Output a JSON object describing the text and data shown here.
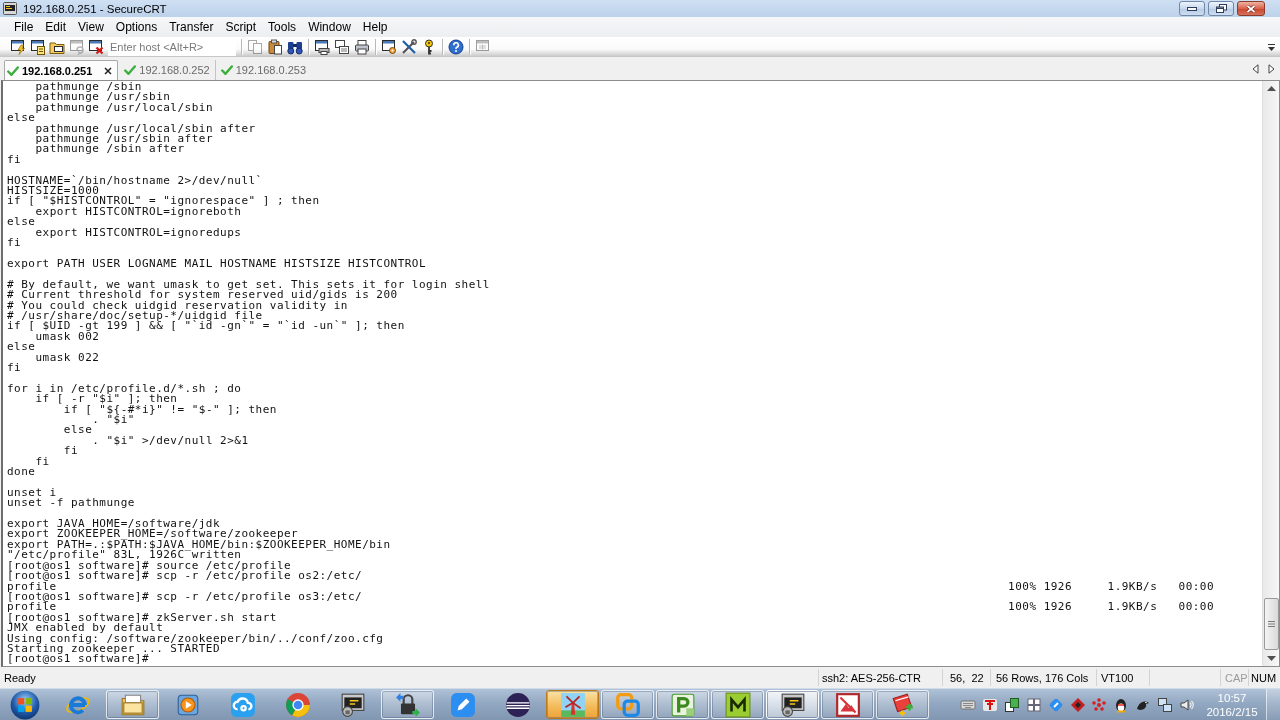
{
  "window": {
    "title": "192.168.0.251 - SecureCRT"
  },
  "menu": [
    "File",
    "Edit",
    "View",
    "Options",
    "Transfer",
    "Script",
    "Tools",
    "Window",
    "Help"
  ],
  "toolbar": {
    "session_buttons": [
      {
        "disabled": false
      },
      {
        "disabled": false
      },
      {
        "disabled": false
      },
      {
        "disabled": true
      },
      {
        "disabled": false
      }
    ],
    "host_field": {
      "placeholder": "Enter host <Alt+R>"
    },
    "groups": [
      [
        {
          "disabled": true
        },
        {
          "disabled": false
        },
        {
          "disabled": false
        }
      ],
      [
        {
          "disabled": false
        },
        {
          "disabled": false
        },
        {
          "disabled": false
        }
      ],
      [
        {
          "disabled": false
        },
        {
          "disabled": false
        },
        {
          "disabled": false
        }
      ],
      [
        {
          "disabled": false
        }
      ],
      [
        {
          "disabled": true
        }
      ]
    ]
  },
  "tabs": [
    {
      "label": "192.168.0.251",
      "selected": true,
      "connected": true
    },
    {
      "label": "192.168.0.252",
      "selected": false,
      "connected": true
    },
    {
      "label": "192.168.0.253",
      "selected": false,
      "connected": true
    }
  ],
  "terminal": {
    "blocks": [
      [
        "    pathmunge /sbin",
        "    pathmunge /usr/sbin",
        "    pathmunge /usr/local/sbin",
        "else",
        "    pathmunge /usr/local/sbin after",
        "    pathmunge /usr/sbin after",
        "    pathmunge /sbin after",
        "fi"
      ],
      [
        "HOSTNAME=`/bin/hostname 2>/dev/null`",
        "HISTSIZE=1000",
        "if [ \"$HISTCONTROL\" = \"ignorespace\" ] ; then",
        "    export HISTCONTROL=ignoreboth",
        "else",
        "    export HISTCONTROL=ignoredups",
        "fi"
      ],
      [
        "export PATH USER LOGNAME MAIL HOSTNAME HISTSIZE HISTCONTROL"
      ],
      [
        "# By default, we want umask to get set. This sets it for login shell",
        "# Current threshold for system reserved uid/gids is 200",
        "# You could check uidgid reservation validity in",
        "# /usr/share/doc/setup-*/uidgid file",
        "if [ $UID -gt 199 ] && [ \"`id -gn`\" = \"`id -un`\" ]; then",
        "    umask 002",
        "else",
        "    umask 022",
        "fi"
      ],
      [
        "for i in /etc/profile.d/*.sh ; do",
        "    if [ -r \"$i\" ]; then",
        "        if [ \"${-#*i}\" != \"$-\" ]; then",
        "            . \"$i\"",
        "        else",
        "            . \"$i\" >/dev/null 2>&1",
        "        fi",
        "    fi",
        "done"
      ],
      [
        "unset i",
        "unset -f pathmunge"
      ],
      [
        "export JAVA_HOME=/software/jdk",
        "export ZOOKEEPER_HOME=/software/zookeeper",
        "export PATH=.:$PATH:$JAVA_HOME/bin:$ZOOKEEPER_HOME/bin",
        "\"/etc/profile\" 83L, 1926C written",
        "[root@os1 software]# source /etc/profile",
        "[root@os1 software]# scp -r /etc/profile os2:/etc/",
        {
          "kind": "transfer",
          "file": "profile",
          "percent": "100%",
          "size": "1926",
          "rate": "1.9KB/s",
          "time": "00:00"
        },
        "[root@os1 software]# scp -r /etc/profile os3:/etc/",
        {
          "kind": "transfer",
          "file": "profile",
          "percent": "100%",
          "size": "1926",
          "rate": "1.9KB/s",
          "time": "00:00"
        },
        "[root@os1 software]# zkServer.sh start",
        "JMX enabled by default",
        "Using config: /software/zookeeper/bin/../conf/zoo.cfg",
        "Starting zookeeper ... STARTED",
        "[root@os1 software]#"
      ]
    ]
  },
  "status_bar": {
    "message": "Ready",
    "panes": [
      "ssh2: AES-256-CTR",
      "56,  22",
      "56 Rows, 176 Cols",
      "VT100"
    ],
    "indicators": [
      {
        "label": "CAP",
        "on": false
      },
      {
        "label": "NUM",
        "on": true
      }
    ]
  },
  "taskbar": {
    "items": [
      {
        "running": false,
        "selected": false,
        "flashing": false
      },
      {
        "running": true,
        "selected": false,
        "flashing": false
      },
      {
        "running": false,
        "selected": false,
        "flashing": false
      },
      {
        "running": false,
        "selected": false,
        "flashing": false
      },
      {
        "running": false,
        "selected": false,
        "flashing": false
      },
      {
        "running": false,
        "selected": false,
        "flashing": false
      },
      {
        "running": true,
        "selected": false,
        "flashing": false
      },
      {
        "running": false,
        "selected": false,
        "flashing": false
      },
      {
        "running": false,
        "selected": false,
        "flashing": false
      },
      {
        "running": true,
        "selected": false,
        "flashing": true
      },
      {
        "running": true,
        "selected": false,
        "flashing": false
      },
      {
        "running": true,
        "selected": false,
        "flashing": false
      },
      {
        "running": true,
        "selected": false,
        "flashing": false
      },
      {
        "running": true,
        "selected": true,
        "flashing": false
      },
      {
        "running": true,
        "selected": false,
        "flashing": false
      },
      {
        "running": true,
        "selected": false,
        "flashing": false
      }
    ],
    "clock": {
      "time": "10:57",
      "date": "2016/2/15"
    }
  }
}
